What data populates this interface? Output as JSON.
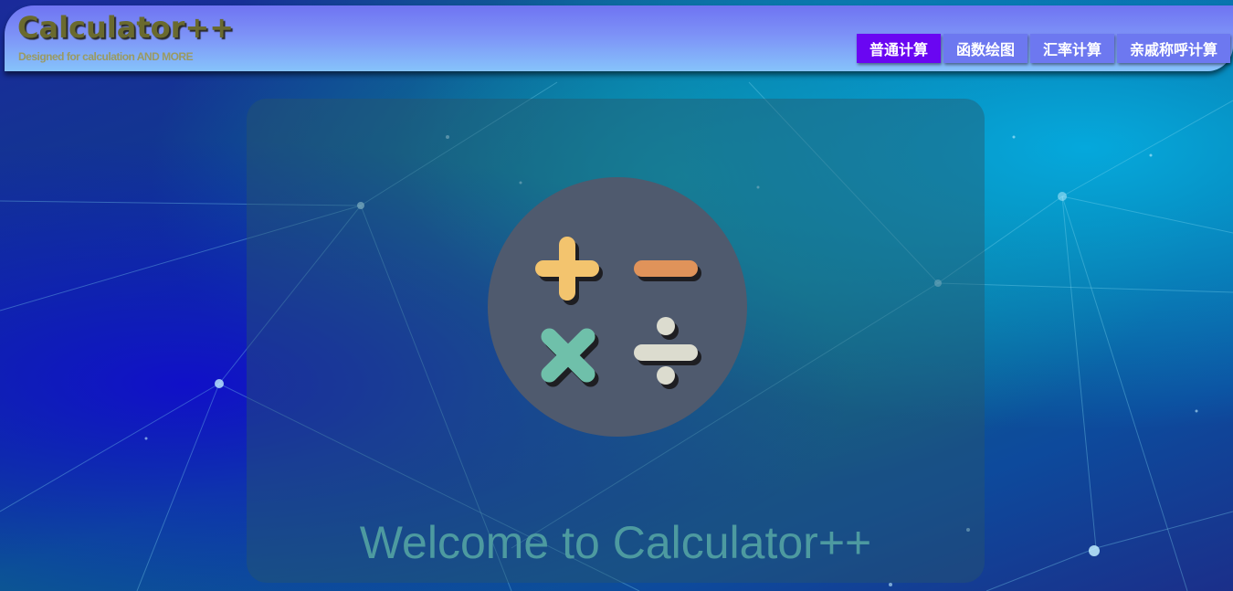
{
  "header": {
    "title": "Calculator++",
    "subtitle": "Designed for calculation AND MORE"
  },
  "nav": {
    "tabs": [
      {
        "label": "普通计算",
        "active": true
      },
      {
        "label": "函数绘图",
        "active": false
      },
      {
        "label": "汇率计算",
        "active": false
      },
      {
        "label": "亲戚称呼计算",
        "active": false
      }
    ]
  },
  "main": {
    "logo_icon": "calculator-operators-icon",
    "welcome_text": "Welcome to Calculator++"
  },
  "colors": {
    "active_tab": "#6a06f2",
    "inactive_tab": "#6d78f0",
    "plus": "#f3c46e",
    "minus": "#e0935a",
    "times": "#6fc0aa",
    "divide": "#dcdccf",
    "logo_circle": "#4f5a6e"
  }
}
